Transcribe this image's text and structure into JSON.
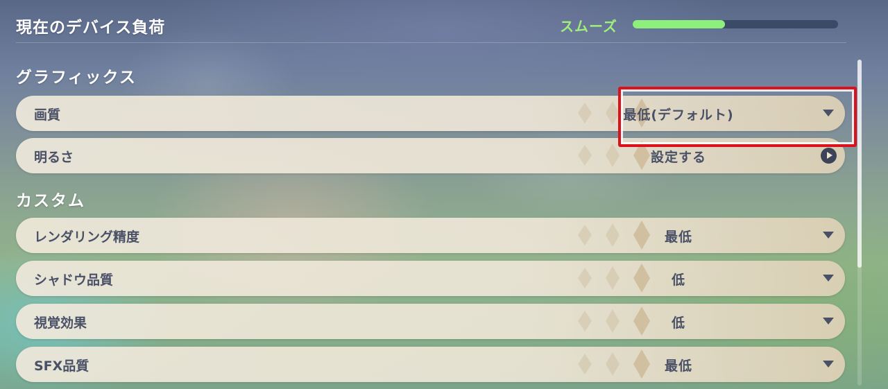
{
  "header": {
    "title": "現在のデバイス負荷",
    "load_status": "スムーズ",
    "load_level": 0.45,
    "load_color": "#8ef07c"
  },
  "sections": {
    "graphics": {
      "title": "グラフィックス",
      "rows": [
        {
          "label": "画質",
          "value": "最低(デフォルト)",
          "control": "chevron-down-icon"
        },
        {
          "label": "明るさ",
          "value": "設定する",
          "control": "arrow-right-circle-icon"
        }
      ]
    },
    "custom": {
      "title": "カスタム",
      "rows": [
        {
          "label": "レンダリング精度",
          "value": "最低",
          "control": "chevron-down-icon"
        },
        {
          "label": "シャドウ品質",
          "value": "低",
          "control": "chevron-down-icon"
        },
        {
          "label": "視覚効果",
          "value": "低",
          "control": "chevron-down-icon"
        },
        {
          "label": "SFX品質",
          "value": "最低",
          "control": "chevron-down-icon"
        }
      ]
    }
  },
  "highlight_color": "#d9121b"
}
